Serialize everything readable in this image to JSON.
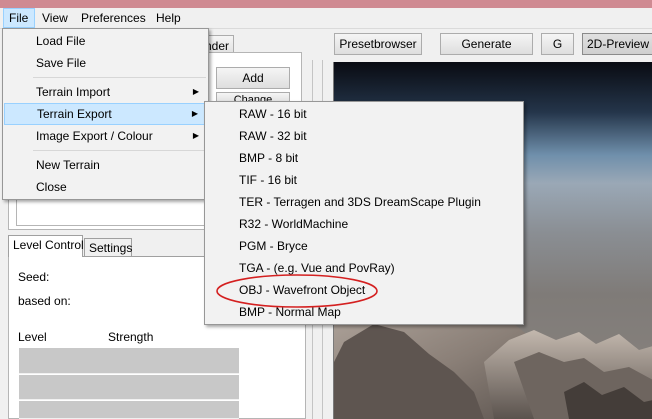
{
  "menubar": {
    "items": [
      {
        "label": "File"
      },
      {
        "label": "View"
      },
      {
        "label": "Preferences"
      },
      {
        "label": "Help"
      }
    ]
  },
  "toolbar": {
    "partial_tab_label": "nder",
    "presetbrowser_label": "Presetbrowser",
    "generate_label": "Generate",
    "g_label": "G",
    "preview_2d_label": "2D-Preview"
  },
  "left_panel": {
    "add_label": "Add",
    "change_label_partial": "Change",
    "tabs": [
      {
        "label": "Level Control"
      },
      {
        "label": "Settings"
      }
    ],
    "seed_label": "Seed:",
    "based_on_label": "based on:",
    "level_header": "Level",
    "strength_header": "Strength"
  },
  "file_menu": {
    "items": [
      {
        "label": "Load File"
      },
      {
        "label": "Save File"
      },
      {
        "label": "Terrain Import",
        "has_submenu": true
      },
      {
        "label": "Terrain Export",
        "has_submenu": true,
        "highlighted": true
      },
      {
        "label": "Image Export / Colour",
        "has_submenu": true
      },
      {
        "label": "New Terrain"
      },
      {
        "label": "Close"
      }
    ],
    "submenu_arrow_glyph": "▶"
  },
  "export_submenu": {
    "items": [
      {
        "label": "RAW - 16 bit"
      },
      {
        "label": "RAW - 32 bit"
      },
      {
        "label": "BMP - 8 bit"
      },
      {
        "label": "TIF - 16 bit"
      },
      {
        "label": "TER - Terragen and 3DS DreamScape Plugin"
      },
      {
        "label": "R32 - WorldMachine"
      },
      {
        "label": "PGM - Bryce"
      },
      {
        "label": "TGA - (e.g. Vue and PovRay)"
      },
      {
        "label": "OBJ - Wavefront Object",
        "circled": true
      },
      {
        "label": "BMP - Normal Map"
      }
    ]
  },
  "colors": {
    "highlight": "#cce8ff",
    "annotation_circle": "#d42020",
    "window_frame": "#cf8a92"
  }
}
